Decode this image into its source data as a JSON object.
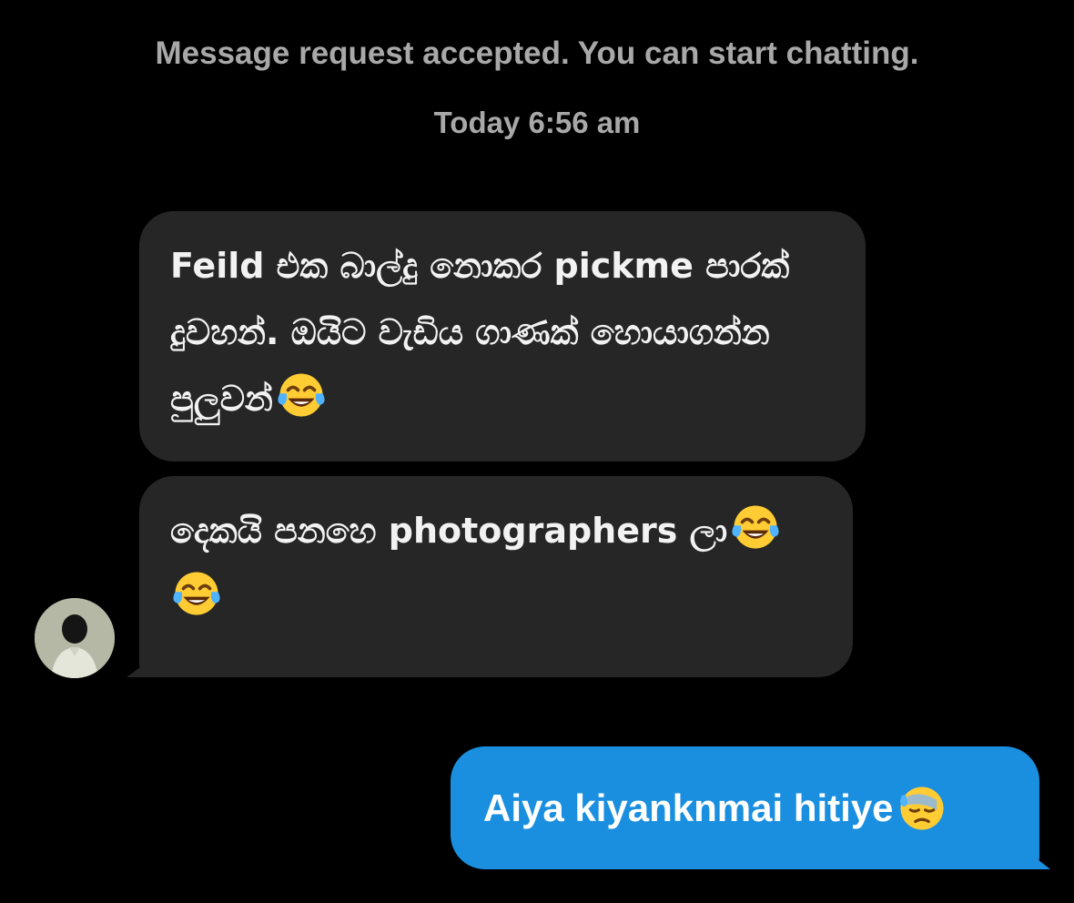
{
  "system": {
    "request_notice": "Message request accepted. You can start chatting.",
    "timestamp": "Today 6:56 am"
  },
  "messages": [
    {
      "direction": "incoming",
      "text": "Feild එක බාල්දු නොකර pickme පාරක් දුවහන්. ඔයිට වැඩිය ගාණක් හොයාගන්න පුලුවන්",
      "emoji": [
        "face-with-tears-of-joy-icon"
      ]
    },
    {
      "direction": "incoming",
      "text": "දෙකයි පනහෙ photographers ලා",
      "emoji": [
        "face-with-tears-of-joy-icon",
        "face-with-tears-of-joy-icon"
      ]
    },
    {
      "direction": "outgoing",
      "text": "Aiya kiyanknmai hitiye",
      "emoji": [
        "downcast-face-with-sweat-icon"
      ]
    }
  ],
  "colors": {
    "background": "#000000",
    "incoming_bubble": "#262626",
    "outgoing_bubble": "#1a8fdf",
    "system_text": "#a8a8a8"
  }
}
